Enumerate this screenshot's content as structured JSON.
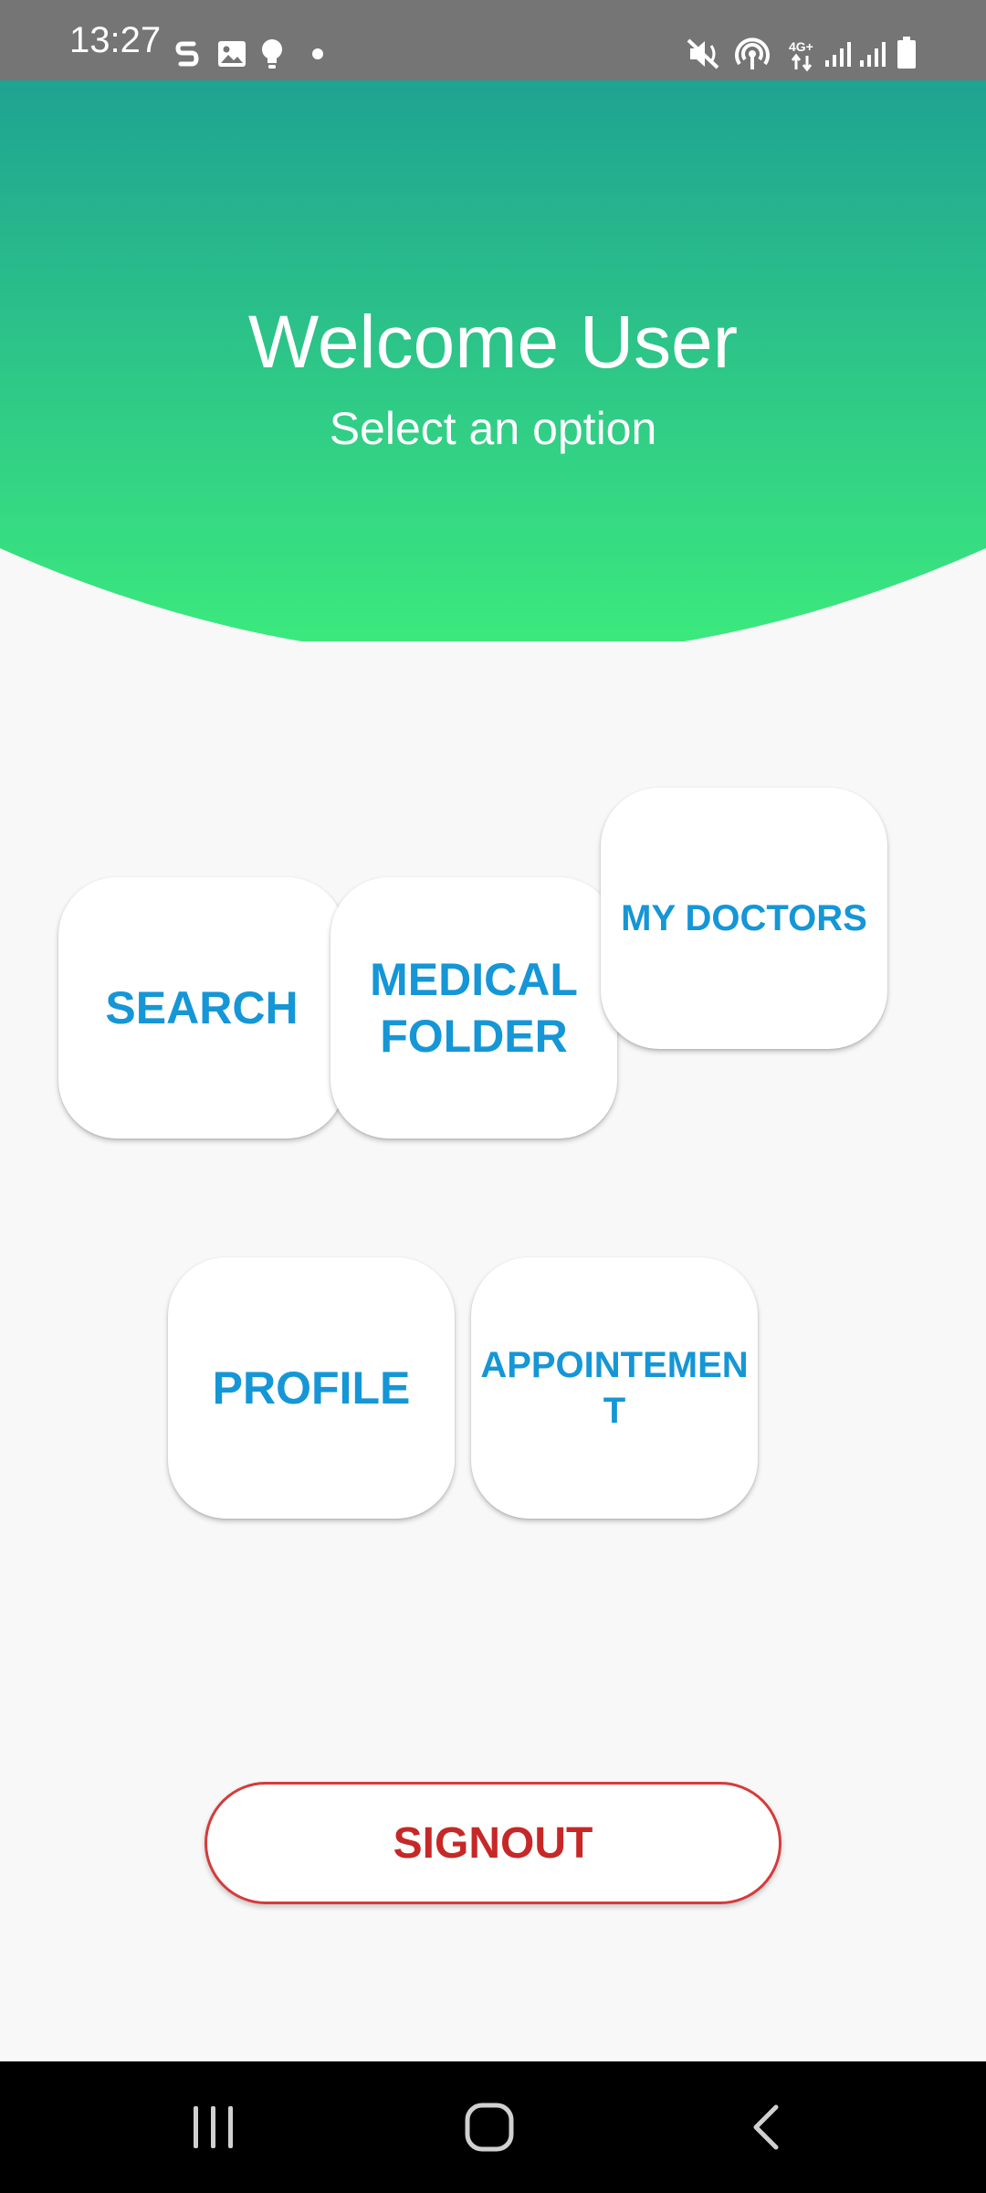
{
  "status_bar": {
    "time": "13:27",
    "left_icons": [
      "sync-icon",
      "image-icon",
      "lightbulb-icon",
      "dot-icon"
    ],
    "right_icons": [
      "mute-vibrate-icon",
      "hotspot-icon",
      "network-4g-plus-icon",
      "signal-icon",
      "signal-icon",
      "battery-icon"
    ],
    "background": "#757575"
  },
  "header": {
    "title": "Welcome User",
    "subtitle": "Select an option",
    "gradient_top": "#1fa392",
    "gradient_bottom": "#3ceb7d"
  },
  "options": {
    "search": "SEARCH",
    "medical_folder": "MEDICAL FOLDER",
    "my_doctors": "MY DOCTORS",
    "profile": "PROFILE",
    "appointment": "APPOINTEMENT",
    "text_color": "#1596d6"
  },
  "signout": {
    "label": "SIGNOUT",
    "color": "#c62828"
  },
  "nav_bar": {
    "items": [
      "recent-apps-icon",
      "home-icon",
      "back-icon"
    ]
  }
}
